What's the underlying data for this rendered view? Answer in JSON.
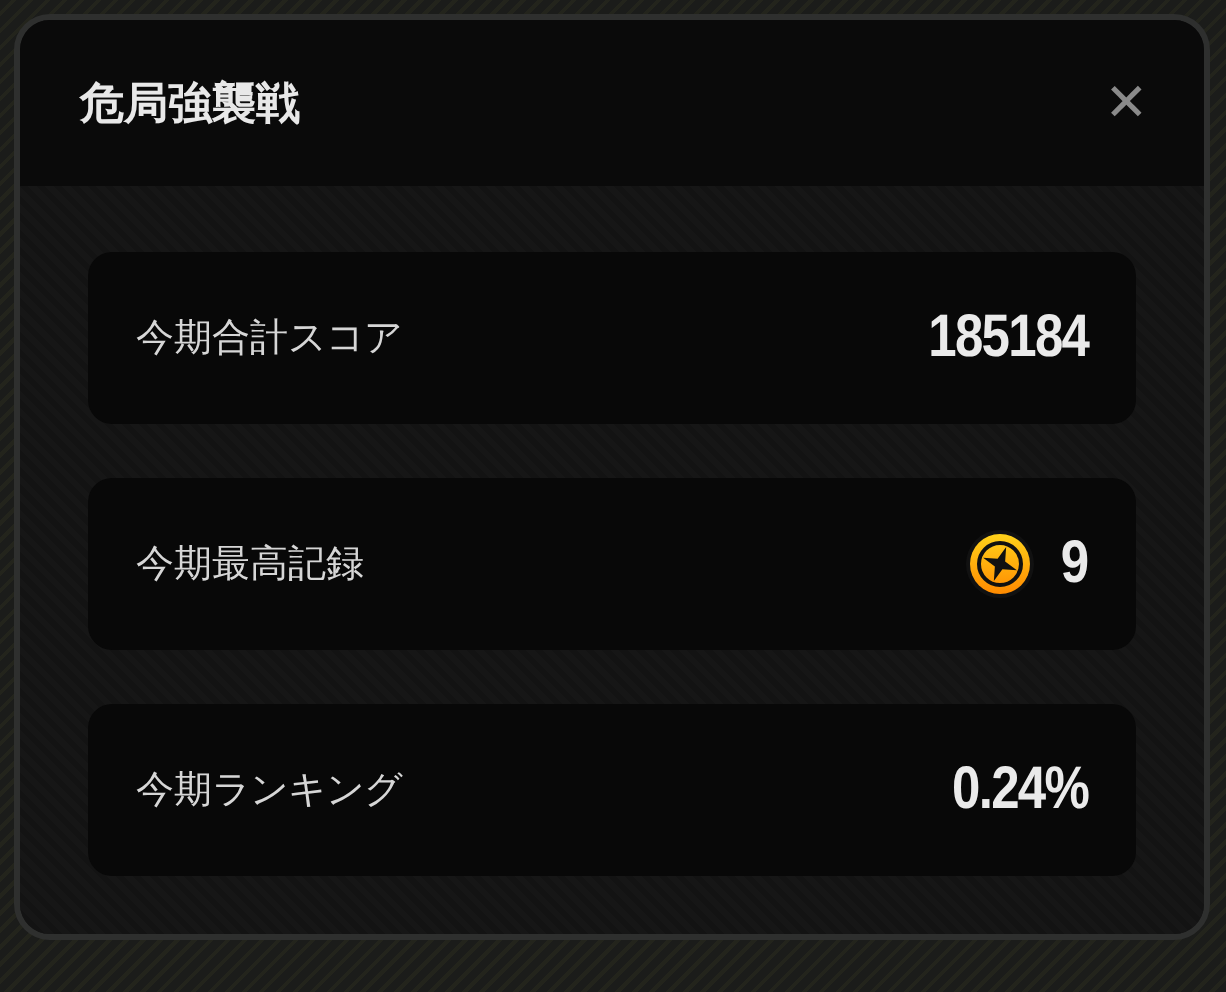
{
  "dialog": {
    "title": "危局強襲戦",
    "close": "✕"
  },
  "stats": [
    {
      "kind": "text",
      "label": "今期合計スコア",
      "value": "185184"
    },
    {
      "kind": "badge",
      "label": "今期最高記録",
      "value": "9"
    },
    {
      "kind": "text",
      "label": "今期ランキング",
      "value": "0.24%"
    }
  ]
}
